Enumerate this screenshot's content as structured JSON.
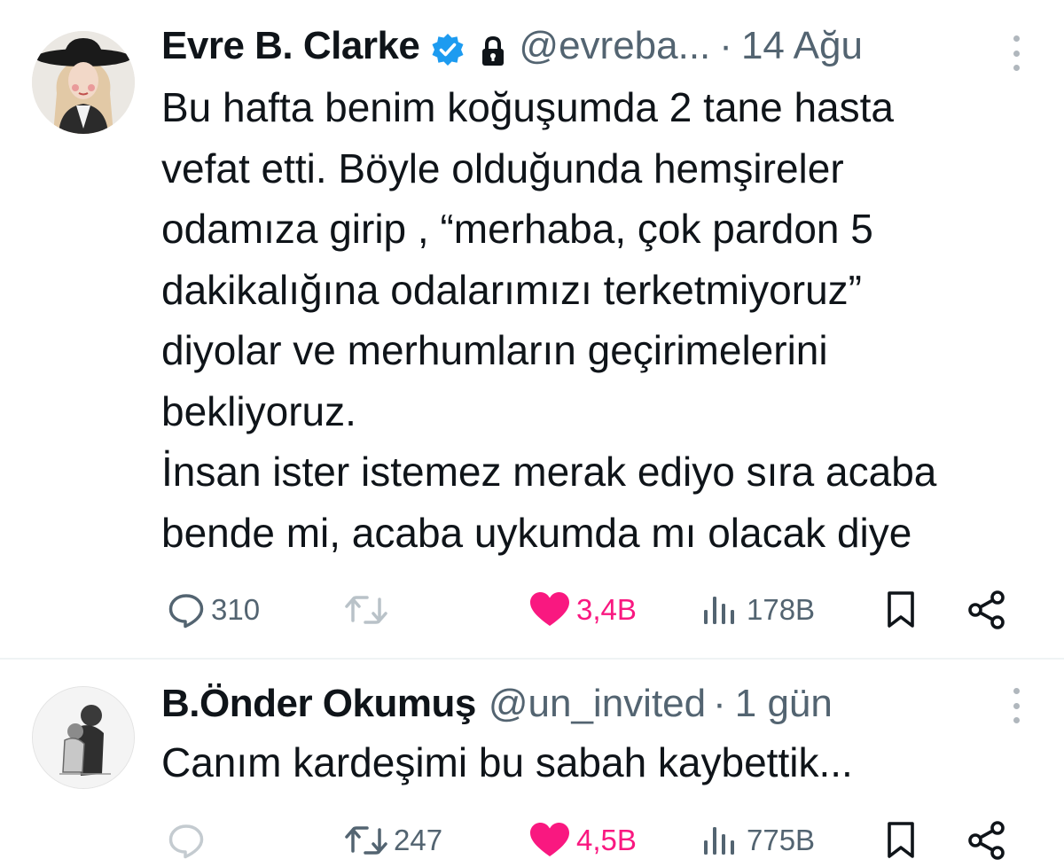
{
  "tweets": [
    {
      "author_name": "Evre B. Clarke",
      "handle": "@evreba...",
      "separator": "·",
      "time": "14 Ağu",
      "verified": true,
      "protected": true,
      "text": "Bu hafta benim koğuşumda 2 tane hasta\nvefat etti. Böyle olduğunda hemşireler\nodamıza girip , “merhaba, çok pardon 5\ndakikalığına odalarımızı terketmiyoruz”\ndiyolar ve merhumların geçirimelerini\nbekliyoruz.\nİnsan ister istemez merak ediyo sıra acaba\nbende mi, acaba uykumda mı olacak diye",
      "replies": "310",
      "retweets": "",
      "likes": "3,4B",
      "views": "178B"
    },
    {
      "author_name": "B.Önder Okumuş",
      "handle": "@un_invited",
      "separator": "·",
      "time": "1 gün",
      "verified": false,
      "protected": false,
      "text": "Canım kardeşimi bu sabah kaybettik...",
      "replies": "",
      "retweets": "247",
      "likes": "4,5B",
      "views": "775B"
    }
  ],
  "icons": {
    "reply": "reply-icon",
    "retweet": "retweet-icon",
    "like": "heart-icon",
    "views": "views-icon",
    "bookmark": "bookmark-icon",
    "share": "share-icon",
    "verified": "verified-badge-icon",
    "lock": "lock-icon",
    "more": "more-vertical-icon"
  },
  "colors": {
    "text": "#0f1419",
    "secondary": "#536471",
    "like": "#f91880",
    "verified": "#1d9bf0",
    "divider": "#eff3f4"
  }
}
